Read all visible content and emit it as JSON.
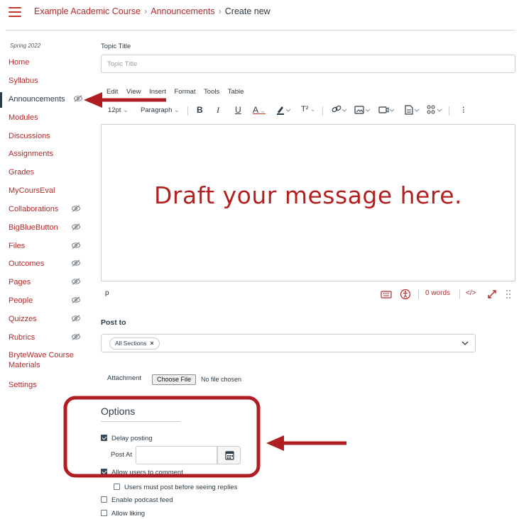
{
  "header": {
    "crumbs": [
      "Example Academic Course",
      "Announcements"
    ],
    "current": "Create new"
  },
  "sidebar": {
    "term": "Spring 2022",
    "items": [
      {
        "label": "Home",
        "hidden": false
      },
      {
        "label": "Syllabus",
        "hidden": false
      },
      {
        "label": "Announcements",
        "hidden": true,
        "active": true
      },
      {
        "label": "Modules",
        "hidden": false
      },
      {
        "label": "Discussions",
        "hidden": false
      },
      {
        "label": "Assignments",
        "hidden": false
      },
      {
        "label": "Grades",
        "hidden": false
      },
      {
        "label": "MyCoursEval",
        "hidden": false
      },
      {
        "label": "Collaborations",
        "hidden": true
      },
      {
        "label": "BigBlueButton",
        "hidden": true
      },
      {
        "label": "Files",
        "hidden": true
      },
      {
        "label": "Outcomes",
        "hidden": true
      },
      {
        "label": "Pages",
        "hidden": true
      },
      {
        "label": "People",
        "hidden": true
      },
      {
        "label": "Quizzes",
        "hidden": true
      },
      {
        "label": "Rubrics",
        "hidden": true
      },
      {
        "label": "BryteWave Course Materials",
        "hidden": false
      },
      {
        "label": "Settings",
        "hidden": false
      }
    ]
  },
  "form": {
    "topic_label": "Topic Title",
    "topic_placeholder": "Topic Title",
    "menubar": [
      "Edit",
      "View",
      "Insert",
      "Format",
      "Tools",
      "Table"
    ],
    "toolbar": {
      "font_size": "12pt",
      "block_format": "Paragraph",
      "bold": "B",
      "italic": "I",
      "underline": "U",
      "text_color": "A",
      "superscript": "T²",
      "more": "⋮"
    },
    "editor_message": "Draft your message here.",
    "status_path": "p",
    "word_count": "0 words",
    "html_toggle": "</>",
    "post_to_label": "Post to",
    "post_to_chip": "All Sections",
    "attachment_label": "Attachment",
    "choose_file": "Choose File",
    "no_file": "No file chosen"
  },
  "options": {
    "title": "Options",
    "delay_posting": {
      "label": "Delay posting",
      "checked": true
    },
    "post_at_label": "Post At",
    "allow_comment": {
      "label": "Allow users to comment",
      "checked": true
    },
    "must_post": {
      "label": "Users must post before seeing replies",
      "checked": false
    },
    "podcast": {
      "label": "Enable podcast feed",
      "checked": false
    },
    "liking": {
      "label": "Allow liking",
      "checked": false
    }
  },
  "colors": {
    "brand": "#b52a2a",
    "text": "#2d3b45",
    "annotation": "#b01e24"
  }
}
